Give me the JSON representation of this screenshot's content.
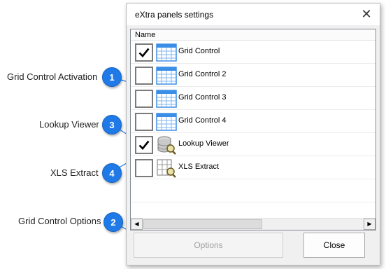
{
  "dialog": {
    "title": "eXtra panels settings",
    "close_glyph": "✕",
    "column_header": "Name",
    "rows": [
      {
        "label": "Grid Control",
        "checked": true,
        "icon": "grid-icon"
      },
      {
        "label": "Grid Control 2",
        "checked": false,
        "icon": "grid-icon"
      },
      {
        "label": "Grid Control 3",
        "checked": false,
        "icon": "grid-icon"
      },
      {
        "label": "Grid Control 4",
        "checked": false,
        "icon": "grid-icon"
      },
      {
        "label": "Lookup Viewer",
        "checked": true,
        "icon": "database-search-icon"
      },
      {
        "label": "XLS Extract",
        "checked": false,
        "icon": "spreadsheet-search-icon"
      }
    ],
    "scroll_left": "◀",
    "scroll_right": "▶",
    "options_label": "Options",
    "options_enabled": false,
    "close_label": "Close"
  },
  "callouts": [
    {
      "number": "1",
      "label": "Grid Control Activation"
    },
    {
      "number": "3",
      "label": "Lookup Viewer"
    },
    {
      "number": "4",
      "label": "XLS Extract"
    },
    {
      "number": "2",
      "label": "Grid Control Options"
    }
  ],
  "colors": {
    "badge": "#1f7ae8",
    "grid_header": "#3a8ee6"
  }
}
